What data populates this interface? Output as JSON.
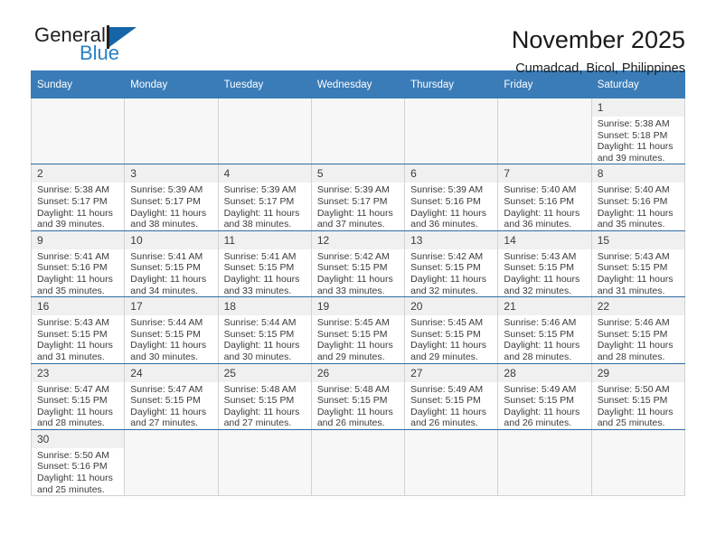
{
  "brand": {
    "name_top": "General",
    "name_bottom": "Blue",
    "flag_icon": "flag-triangle-icon",
    "colors": {
      "black": "#231f20",
      "blue": "#2980c4",
      "flag": "#1565a8"
    }
  },
  "header": {
    "title": "November 2025",
    "subtitle": "Cumadcad, Bicol, Philippines"
  },
  "theme": {
    "header_bar": "#3a7cb8",
    "day_number_bg": "#f0f0f0",
    "text": "#3b3b3b",
    "row_divider": "#2e6ca4"
  },
  "weekdays": [
    "Sunday",
    "Monday",
    "Tuesday",
    "Wednesday",
    "Thursday",
    "Friday",
    "Saturday"
  ],
  "weeks": [
    [
      {
        "blank": true
      },
      {
        "blank": true
      },
      {
        "blank": true
      },
      {
        "blank": true
      },
      {
        "blank": true
      },
      {
        "blank": true
      },
      {
        "day": "1",
        "sunrise": "Sunrise: 5:38 AM",
        "sunset": "Sunset: 5:18 PM",
        "daylight1": "Daylight: 11 hours",
        "daylight2": "and 39 minutes."
      }
    ],
    [
      {
        "day": "2",
        "sunrise": "Sunrise: 5:38 AM",
        "sunset": "Sunset: 5:17 PM",
        "daylight1": "Daylight: 11 hours",
        "daylight2": "and 39 minutes."
      },
      {
        "day": "3",
        "sunrise": "Sunrise: 5:39 AM",
        "sunset": "Sunset: 5:17 PM",
        "daylight1": "Daylight: 11 hours",
        "daylight2": "and 38 minutes."
      },
      {
        "day": "4",
        "sunrise": "Sunrise: 5:39 AM",
        "sunset": "Sunset: 5:17 PM",
        "daylight1": "Daylight: 11 hours",
        "daylight2": "and 38 minutes."
      },
      {
        "day": "5",
        "sunrise": "Sunrise: 5:39 AM",
        "sunset": "Sunset: 5:17 PM",
        "daylight1": "Daylight: 11 hours",
        "daylight2": "and 37 minutes."
      },
      {
        "day": "6",
        "sunrise": "Sunrise: 5:39 AM",
        "sunset": "Sunset: 5:16 PM",
        "daylight1": "Daylight: 11 hours",
        "daylight2": "and 36 minutes."
      },
      {
        "day": "7",
        "sunrise": "Sunrise: 5:40 AM",
        "sunset": "Sunset: 5:16 PM",
        "daylight1": "Daylight: 11 hours",
        "daylight2": "and 36 minutes."
      },
      {
        "day": "8",
        "sunrise": "Sunrise: 5:40 AM",
        "sunset": "Sunset: 5:16 PM",
        "daylight1": "Daylight: 11 hours",
        "daylight2": "and 35 minutes."
      }
    ],
    [
      {
        "day": "9",
        "sunrise": "Sunrise: 5:41 AM",
        "sunset": "Sunset: 5:16 PM",
        "daylight1": "Daylight: 11 hours",
        "daylight2": "and 35 minutes."
      },
      {
        "day": "10",
        "sunrise": "Sunrise: 5:41 AM",
        "sunset": "Sunset: 5:15 PM",
        "daylight1": "Daylight: 11 hours",
        "daylight2": "and 34 minutes."
      },
      {
        "day": "11",
        "sunrise": "Sunrise: 5:41 AM",
        "sunset": "Sunset: 5:15 PM",
        "daylight1": "Daylight: 11 hours",
        "daylight2": "and 33 minutes."
      },
      {
        "day": "12",
        "sunrise": "Sunrise: 5:42 AM",
        "sunset": "Sunset: 5:15 PM",
        "daylight1": "Daylight: 11 hours",
        "daylight2": "and 33 minutes."
      },
      {
        "day": "13",
        "sunrise": "Sunrise: 5:42 AM",
        "sunset": "Sunset: 5:15 PM",
        "daylight1": "Daylight: 11 hours",
        "daylight2": "and 32 minutes."
      },
      {
        "day": "14",
        "sunrise": "Sunrise: 5:43 AM",
        "sunset": "Sunset: 5:15 PM",
        "daylight1": "Daylight: 11 hours",
        "daylight2": "and 32 minutes."
      },
      {
        "day": "15",
        "sunrise": "Sunrise: 5:43 AM",
        "sunset": "Sunset: 5:15 PM",
        "daylight1": "Daylight: 11 hours",
        "daylight2": "and 31 minutes."
      }
    ],
    [
      {
        "day": "16",
        "sunrise": "Sunrise: 5:43 AM",
        "sunset": "Sunset: 5:15 PM",
        "daylight1": "Daylight: 11 hours",
        "daylight2": "and 31 minutes."
      },
      {
        "day": "17",
        "sunrise": "Sunrise: 5:44 AM",
        "sunset": "Sunset: 5:15 PM",
        "daylight1": "Daylight: 11 hours",
        "daylight2": "and 30 minutes."
      },
      {
        "day": "18",
        "sunrise": "Sunrise: 5:44 AM",
        "sunset": "Sunset: 5:15 PM",
        "daylight1": "Daylight: 11 hours",
        "daylight2": "and 30 minutes."
      },
      {
        "day": "19",
        "sunrise": "Sunrise: 5:45 AM",
        "sunset": "Sunset: 5:15 PM",
        "daylight1": "Daylight: 11 hours",
        "daylight2": "and 29 minutes."
      },
      {
        "day": "20",
        "sunrise": "Sunrise: 5:45 AM",
        "sunset": "Sunset: 5:15 PM",
        "daylight1": "Daylight: 11 hours",
        "daylight2": "and 29 minutes."
      },
      {
        "day": "21",
        "sunrise": "Sunrise: 5:46 AM",
        "sunset": "Sunset: 5:15 PM",
        "daylight1": "Daylight: 11 hours",
        "daylight2": "and 28 minutes."
      },
      {
        "day": "22",
        "sunrise": "Sunrise: 5:46 AM",
        "sunset": "Sunset: 5:15 PM",
        "daylight1": "Daylight: 11 hours",
        "daylight2": "and 28 minutes."
      }
    ],
    [
      {
        "day": "23",
        "sunrise": "Sunrise: 5:47 AM",
        "sunset": "Sunset: 5:15 PM",
        "daylight1": "Daylight: 11 hours",
        "daylight2": "and 28 minutes."
      },
      {
        "day": "24",
        "sunrise": "Sunrise: 5:47 AM",
        "sunset": "Sunset: 5:15 PM",
        "daylight1": "Daylight: 11 hours",
        "daylight2": "and 27 minutes."
      },
      {
        "day": "25",
        "sunrise": "Sunrise: 5:48 AM",
        "sunset": "Sunset: 5:15 PM",
        "daylight1": "Daylight: 11 hours",
        "daylight2": "and 27 minutes."
      },
      {
        "day": "26",
        "sunrise": "Sunrise: 5:48 AM",
        "sunset": "Sunset: 5:15 PM",
        "daylight1": "Daylight: 11 hours",
        "daylight2": "and 26 minutes."
      },
      {
        "day": "27",
        "sunrise": "Sunrise: 5:49 AM",
        "sunset": "Sunset: 5:15 PM",
        "daylight1": "Daylight: 11 hours",
        "daylight2": "and 26 minutes."
      },
      {
        "day": "28",
        "sunrise": "Sunrise: 5:49 AM",
        "sunset": "Sunset: 5:15 PM",
        "daylight1": "Daylight: 11 hours",
        "daylight2": "and 26 minutes."
      },
      {
        "day": "29",
        "sunrise": "Sunrise: 5:50 AM",
        "sunset": "Sunset: 5:15 PM",
        "daylight1": "Daylight: 11 hours",
        "daylight2": "and 25 minutes."
      }
    ],
    [
      {
        "day": "30",
        "sunrise": "Sunrise: 5:50 AM",
        "sunset": "Sunset: 5:16 PM",
        "daylight1": "Daylight: 11 hours",
        "daylight2": "and 25 minutes."
      },
      {
        "blank": true
      },
      {
        "blank": true
      },
      {
        "blank": true
      },
      {
        "blank": true
      },
      {
        "blank": true
      },
      {
        "blank": true
      }
    ]
  ]
}
